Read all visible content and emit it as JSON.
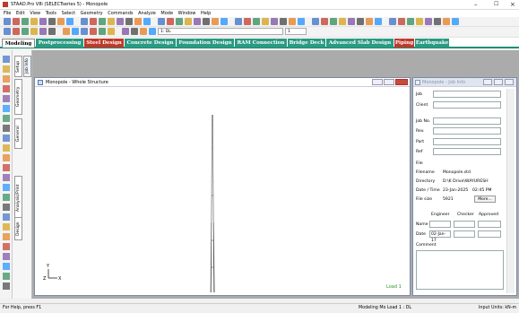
{
  "window": {
    "title": "STAAD.Pro V8i (SELECTseries 5) - Monopole"
  },
  "menu": [
    "File",
    "Edit",
    "View",
    "Tools",
    "Select",
    "Geometry",
    "Commands",
    "Analyze",
    "Mode",
    "Window",
    "Help"
  ],
  "toolbar": {
    "load_case_value": "1: DL",
    "small_field_value": "1"
  },
  "tabs": [
    {
      "label": "Modeling",
      "active": true
    },
    {
      "label": "Postprocessing"
    },
    {
      "label": "Steel Design"
    },
    {
      "label": "Concrete Design"
    },
    {
      "label": "Foundation Design"
    },
    {
      "label": "RAM Connection"
    },
    {
      "label": "Bridge Deck"
    },
    {
      "label": "Advanced Slab Design"
    },
    {
      "label": "Piping"
    },
    {
      "label": "Earthquake"
    }
  ],
  "side_tabs": [
    "Setup",
    "Geometry",
    "General",
    "Analysis/Print",
    "Design"
  ],
  "side_tabs_inner": [
    "Job Info"
  ],
  "view_window": {
    "title": "Monopole - Whole Structure",
    "load_label": "Load 1",
    "axis_y": "Y",
    "axis_x": "X",
    "axis_z": "Z"
  },
  "info_window": {
    "title": "Monopole - Job Info",
    "fields": {
      "job": "Job",
      "client": "Client",
      "job_no": "Job No.",
      "rev": "Rev.",
      "part": "Part",
      "ref": "Ref"
    },
    "file_section": "File",
    "filename_label": "Filename",
    "filename_value": "Monopole.std",
    "directory_label": "Directory",
    "directory_value": "D:\\K Drive\\WAYURESH",
    "datetime_label": "Date / Time",
    "date_value": "23-Jan-2025",
    "time_value": "02:45 PM",
    "filesize_label": "File size",
    "filesize_value": "5921",
    "more_button": "More...",
    "engineer_label": "Engineer",
    "checker_label": "Checker",
    "approved_label": "Approved",
    "name_label": "Name",
    "date_label": "Date",
    "date_field_value": "02-Jan-17",
    "comment_label": "Comment"
  },
  "status": {
    "help": "For Help, press F1",
    "mode": "Modeling Mo Load 1 : DL",
    "units": "Input Units: kN-m"
  }
}
